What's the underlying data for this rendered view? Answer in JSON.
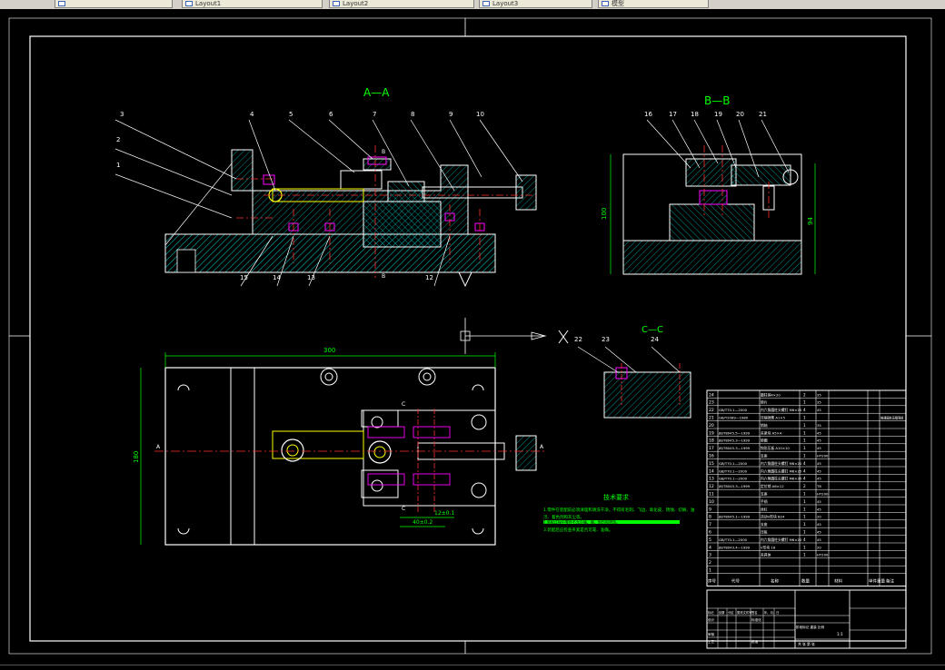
{
  "tabs": [
    {
      "label": ""
    },
    {
      "label": "Layout1"
    },
    {
      "label": "Layout2"
    },
    {
      "label": "Layout3"
    },
    {
      "label": "模型"
    }
  ],
  "section_titles": {
    "aa": "A—A",
    "bb": "B—B",
    "cc": "C—C"
  },
  "section_markers": {
    "b_top": "B",
    "b_bottom": "B",
    "a_left": "A",
    "a_right": "A",
    "c_top": "C",
    "c_bottom": "C"
  },
  "balloons": [
    "1",
    "2",
    "3",
    "4",
    "5",
    "6",
    "7",
    "8",
    "9",
    "10",
    "11",
    "12",
    "13",
    "14",
    "15",
    "16",
    "17",
    "18",
    "19",
    "20",
    "21",
    "22",
    "23",
    "24"
  ],
  "dimensions": {
    "width_300": "300",
    "height_180": "180",
    "bb_height_100": "100",
    "bb_height_94": "94",
    "dim_12": "12±0.1",
    "dim_40": "40±0.2"
  },
  "tech_requirements": {
    "title": "技术要求",
    "lines": [
      "1.零件在装配前必须清理和清洗干净，不得有毛刺、飞边、氧化皮、锈蚀、切屑、油",
      "污、着色剂和灰尘等。",
      "2.装配过程中零件不允许磕、碰、划伤和锈蚀。",
      "3.装配后应检查夹紧是否可靠、准确。"
    ]
  },
  "bom": {
    "rows": [
      {
        "no": "24",
        "code": "",
        "name": "圆柱销4×20",
        "qty": "2",
        "mat": "35"
      },
      {
        "no": "23",
        "code": "",
        "name": "垫片",
        "qty": "1",
        "mat": "35"
      },
      {
        "no": "22",
        "code": "GB/T70.1—2000",
        "name": "内六角圆柱头螺钉 M6×25",
        "qty": "4",
        "mat": "45"
      },
      {
        "no": "21",
        "code": "GB/T2089—1980",
        "name": "压缩弹簧 A1×5",
        "qty": "1",
        "mat": "",
        "note": "普通圆柱压缩弹簧"
      },
      {
        "no": "20",
        "code": "",
        "name": "销轴",
        "qty": "1",
        "mat": "35"
      },
      {
        "no": "19",
        "code": "JB/T8045.5—1999",
        "name": "夹紧块 A5×4",
        "qty": "1",
        "mat": "45"
      },
      {
        "no": "18",
        "code": "JB/T8045.3—1999",
        "name": "垫圈",
        "qty": "1",
        "mat": "45"
      },
      {
        "no": "17",
        "code": "JB/T8045.3—1999",
        "name": "钩形压板 A10×10",
        "qty": "1",
        "mat": "45"
      },
      {
        "no": "16",
        "code": "",
        "name": "支座",
        "qty": "1",
        "mat": "HT200"
      },
      {
        "no": "15",
        "code": "GB/T70.1—2000",
        "name": "内六角圆柱头螺钉 M6×20",
        "qty": "4",
        "mat": "45"
      },
      {
        "no": "14",
        "code": "GB/T70.1—2000",
        "name": "内六角圆柱头螺钉 M6×25",
        "qty": "4",
        "mat": "45"
      },
      {
        "no": "13",
        "code": "GB/T70.1—2000",
        "name": "内六角圆柱头螺钉 M6×35",
        "qty": "4",
        "mat": "45"
      },
      {
        "no": "12",
        "code": "JB/T8045.3—1999",
        "name": "定位销 A6×12",
        "qty": "2",
        "mat": "T8"
      },
      {
        "no": "11",
        "code": "",
        "name": "支座",
        "qty": "1",
        "mat": "HT200"
      },
      {
        "no": "10",
        "code": "",
        "name": "手柄",
        "qty": "1",
        "mat": "45"
      },
      {
        "no": "9",
        "code": "",
        "name": "丝杠",
        "qty": "1",
        "mat": "45"
      },
      {
        "no": "8",
        "code": "JB/T8045.1—1999",
        "name": "活动V形块 B24",
        "qty": "1",
        "mat": "20"
      },
      {
        "no": "7",
        "code": "",
        "name": "支座",
        "qty": "1",
        "mat": "45"
      },
      {
        "no": "6",
        "code": "",
        "name": "压板",
        "qty": "1",
        "mat": "45"
      },
      {
        "no": "5",
        "code": "GB/T70.1—2000",
        "name": "内六角圆柱头螺钉 M6×20",
        "qty": "4",
        "mat": "45"
      },
      {
        "no": "4",
        "code": "JB/T8043.4—1999",
        "name": "V形块 18",
        "qty": "1",
        "mat": "20"
      },
      {
        "no": "3",
        "code": "",
        "name": "夹具体",
        "qty": "1",
        "mat": "HT200"
      },
      {
        "no": "2",
        "code": "",
        "name": "",
        "qty": "",
        "mat": ""
      },
      {
        "no": "1",
        "code": "",
        "name": "",
        "qty": "",
        "mat": ""
      }
    ],
    "header": {
      "no": "序号",
      "code": "代号",
      "name": "名称",
      "qty": "数量",
      "mat": "材料",
      "single": "单件",
      "total": "总计",
      "weight": "重量",
      "note": "备注"
    }
  },
  "title_block": {
    "row1": [
      "标记",
      "处数",
      "分区",
      "更改文件号",
      "签名",
      "年、月、日"
    ],
    "design": "设计",
    "standard": "标准化",
    "stage": "阶段标记",
    "weight": "重量",
    "scale": "比例",
    "scale_value": "1:1",
    "review": "审核",
    "process": "工艺",
    "approve": "批准",
    "sheets": "共  张  第  张"
  },
  "colors": {
    "line": "#ffffff",
    "hatch": "#00b4b4",
    "green": "#00ff00",
    "center": "#ff3030",
    "magenta": "#ff00ff",
    "yellow": "#ffff00",
    "dim": "#00ff00"
  }
}
